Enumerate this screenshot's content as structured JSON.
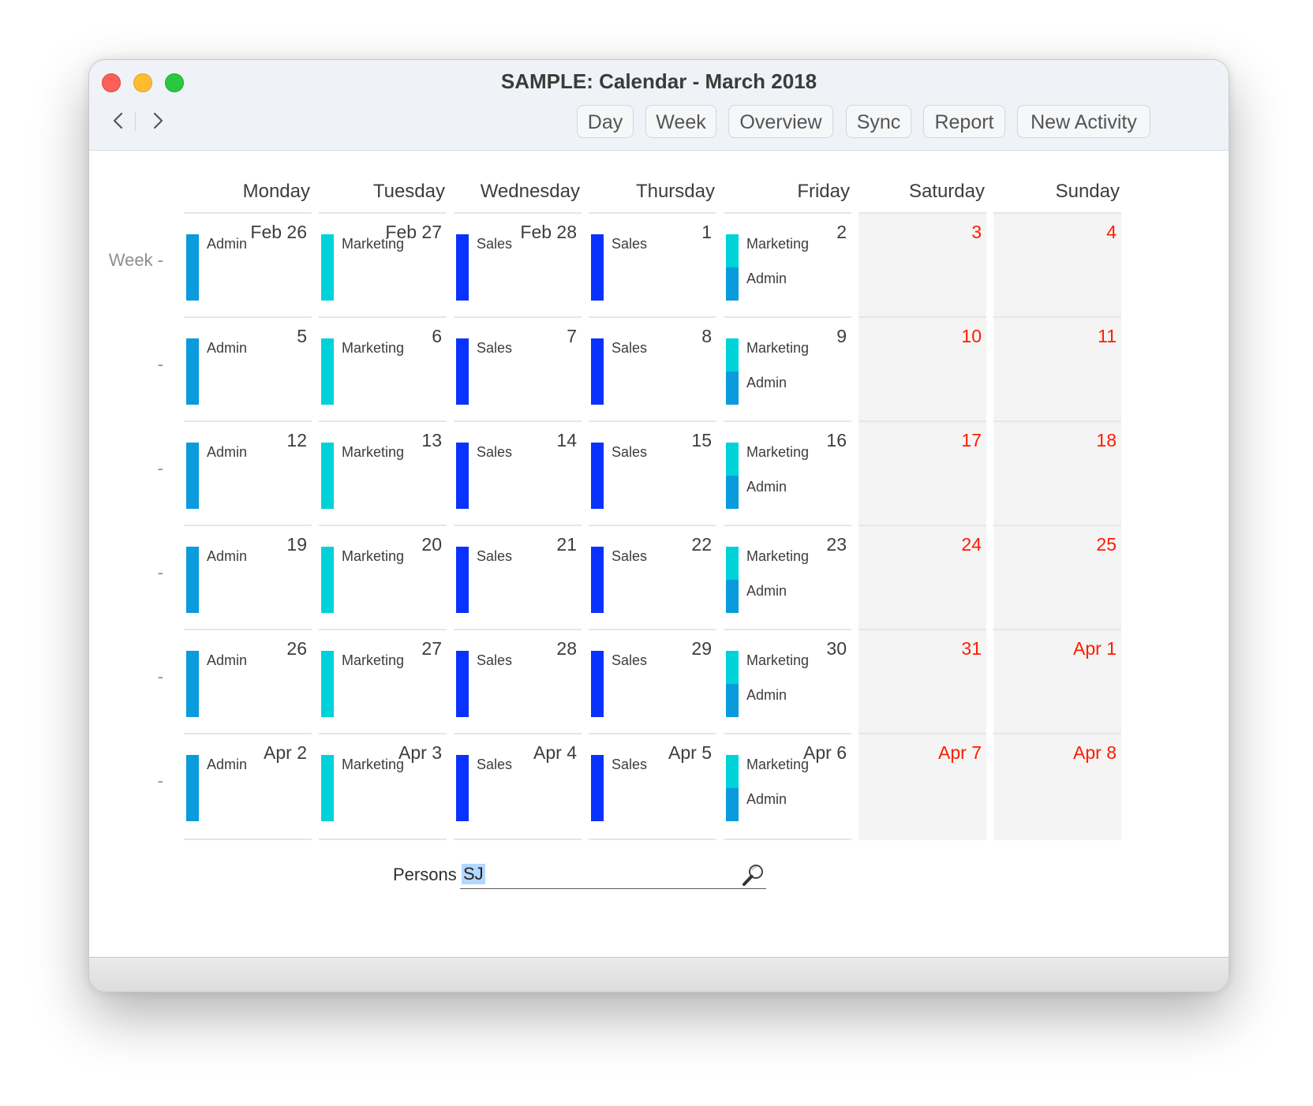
{
  "window": {
    "title": "SAMPLE: Calendar - March 2018"
  },
  "toolbar": {
    "buttons": [
      "Day",
      "Week",
      "Overview",
      "Sync",
      "Report",
      "New Activity"
    ]
  },
  "calendar": {
    "day_names": [
      "Monday",
      "Tuesday",
      "Wednesday",
      "Thursday",
      "Friday",
      "Saturday",
      "Sunday"
    ],
    "week_labels": [
      "Week -",
      "-",
      "-",
      "-",
      "-",
      "-"
    ],
    "colors": {
      "admin": "#0a9bdd",
      "marketing": "#00d2d9",
      "sales": "#0a32ff",
      "weekend_date": "#ff1a00"
    },
    "weeks": [
      [
        "Feb 26",
        "Feb 27",
        "Feb 28",
        "1",
        "2",
        "3",
        "4"
      ],
      [
        "5",
        "6",
        "7",
        "8",
        "9",
        "10",
        "11"
      ],
      [
        "12",
        "13",
        "14",
        "15",
        "16",
        "17",
        "18"
      ],
      [
        "19",
        "20",
        "21",
        "22",
        "23",
        "24",
        "25"
      ],
      [
        "26",
        "27",
        "28",
        "29",
        "30",
        "31",
        "Apr 1"
      ],
      [
        "Apr 2",
        "Apr 3",
        "Apr 4",
        "Apr 5",
        "Apr 6",
        "Apr 7",
        "Apr 8"
      ]
    ],
    "weekday_events": [
      [
        "Admin"
      ],
      [
        "Marketing"
      ],
      [
        "Sales"
      ],
      [
        "Sales"
      ],
      [
        "Marketing",
        "Admin"
      ]
    ]
  },
  "persons": {
    "label": "Persons",
    "value": "SJ"
  }
}
